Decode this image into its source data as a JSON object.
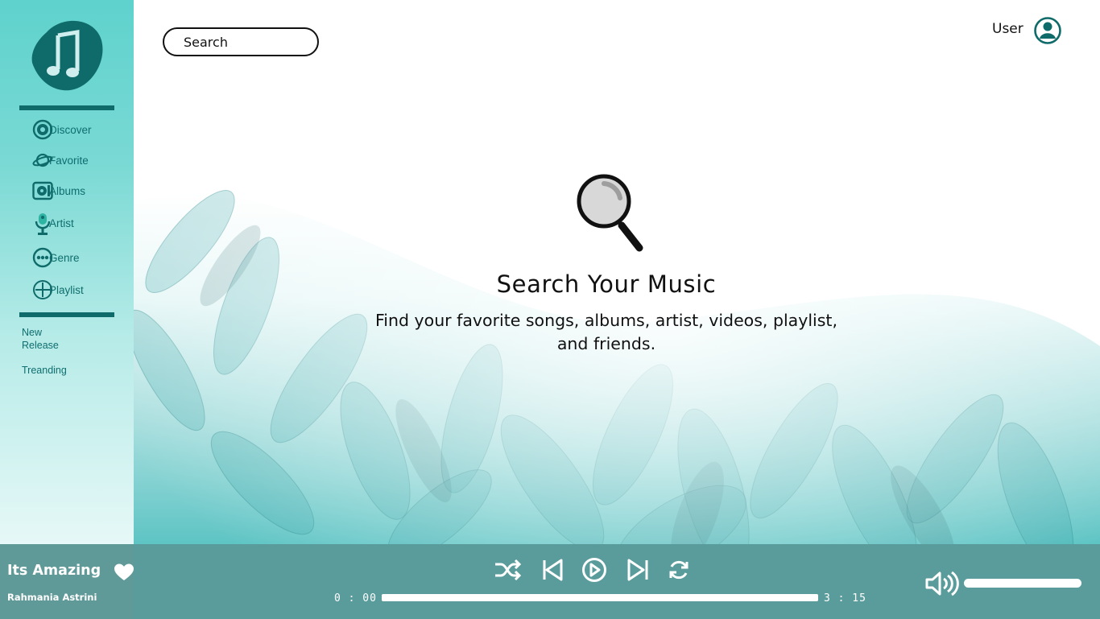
{
  "colors": {
    "accent": "#0f6b6a",
    "sidebar_top": "#5fd2cd",
    "player_bar": "#4e9594",
    "text": "#111111"
  },
  "sidebar": {
    "logo_icon": "music-note-logo-icon",
    "items": [
      {
        "label": "Discover",
        "icon": "disc-icon"
      },
      {
        "label": "Favorite",
        "icon": "planet-icon"
      },
      {
        "label": "Albums",
        "icon": "album-icon"
      },
      {
        "label": "Artist",
        "icon": "microphone-icon"
      },
      {
        "label": "Genre",
        "icon": "more-dots-icon"
      },
      {
        "label": "Playlist",
        "icon": "add-circle-icon"
      }
    ],
    "links": [
      {
        "label": "New\nRelease"
      },
      {
        "label": "Treanding"
      }
    ]
  },
  "header": {
    "search": {
      "placeholder": "Search",
      "value": ""
    },
    "user_label": "User",
    "user_icon": "user-avatar-icon"
  },
  "hero": {
    "icon": "magnifier-icon",
    "title": "Search Your Music",
    "subtitle": "Find your favorite songs, albums, artist, videos, playlist, and friends."
  },
  "player": {
    "song_title": "Its Amazing",
    "artist": "Rahmania Astrini",
    "current_time": "0 : 00",
    "total_time": "3 : 15",
    "progress": 1.0,
    "volume": 1.0,
    "controls": [
      "shuffle-icon",
      "previous-icon",
      "play-icon",
      "next-icon",
      "repeat-icon"
    ]
  }
}
